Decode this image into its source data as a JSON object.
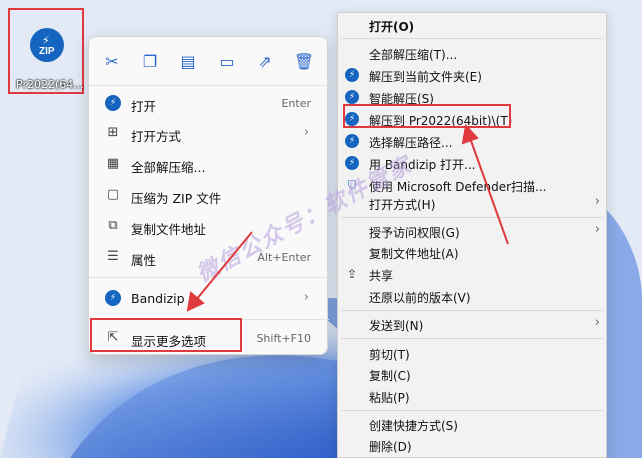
{
  "desktop": {
    "icon_badge": "ZIP",
    "icon_label": "Pr2022(64..."
  },
  "w11_menu": {
    "toolbar": [
      {
        "icon": "cut-icon",
        "glyph": "✂"
      },
      {
        "icon": "copy-icon",
        "glyph": "⧉"
      },
      {
        "icon": "paste-icon",
        "glyph": "📋"
      },
      {
        "icon": "rename-icon",
        "glyph": "⌶"
      },
      {
        "icon": "share-icon",
        "glyph": "↗"
      },
      {
        "icon": "delete-icon",
        "glyph": "🗑"
      }
    ],
    "items": [
      {
        "label": "打开",
        "shortcut": "Enter",
        "icon": "bandizip-icon"
      },
      {
        "label": "打开方式",
        "shortcut": "",
        "icon": "open-with-icon",
        "submenu": true
      },
      {
        "label": "全部解压缩...",
        "shortcut": "",
        "icon": "extract-all-icon"
      },
      {
        "label": "压缩为 ZIP 文件",
        "shortcut": "",
        "icon": "zip-icon"
      },
      {
        "label": "复制文件地址",
        "shortcut": "",
        "icon": "copy-path-icon"
      },
      {
        "label": "属性",
        "shortcut": "Alt+Enter",
        "icon": "properties-icon"
      },
      {
        "label": "Bandizip",
        "shortcut": "",
        "icon": "bandizip-icon",
        "submenu": true
      },
      {
        "label": "显示更多选项",
        "shortcut": "Shift+F10",
        "icon": "more-options-icon"
      }
    ]
  },
  "classic_menu": {
    "items": [
      {
        "label": "打开(O)",
        "bold": true
      },
      {
        "label": "全部解压缩(T)..."
      },
      {
        "label": "解压到当前文件夹(E)",
        "icon": "bandizip"
      },
      {
        "label": "智能解压(S)",
        "icon": "bandizip"
      },
      {
        "label": "解压到 Pr2022(64bit)\\(T)",
        "icon": "bandizip"
      },
      {
        "label": "选择解压路径...",
        "icon": "bandizip"
      },
      {
        "label": "用 Bandizip 打开...",
        "icon": "bandizip"
      },
      {
        "label": "使用 Microsoft Defender扫描...",
        "icon": "defender"
      },
      {
        "label": "打开方式(H)",
        "submenu": true
      },
      {
        "label": "授予访问权限(G)",
        "submenu": true
      },
      {
        "label": "复制文件地址(A)"
      },
      {
        "label": "共享",
        "icon": "share"
      },
      {
        "label": "还原以前的版本(V)"
      },
      {
        "label": "发送到(N)",
        "submenu": true
      },
      {
        "label": "剪切(T)"
      },
      {
        "label": "复制(C)"
      },
      {
        "label": "粘贴(P)"
      },
      {
        "label": "创建快捷方式(S)"
      },
      {
        "label": "删除(D)"
      }
    ]
  },
  "watermark": "微信公众号：软件管家",
  "colors": {
    "highlight": "#e0393e",
    "bandizip": "#1565c0",
    "accent": "#2b66c9"
  }
}
